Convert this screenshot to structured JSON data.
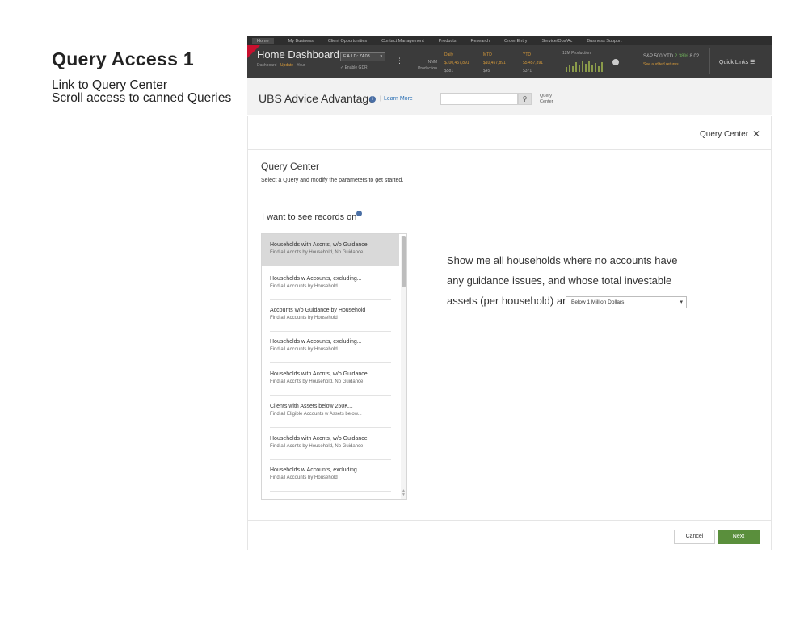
{
  "annotation": {
    "title": "Query Access 1",
    "line1": "Link to Query Center",
    "line2": "Scroll access to canned Queries"
  },
  "topnav": {
    "links": [
      "Home",
      "My Business",
      "Client Opportunities",
      "Contact Management",
      "Products",
      "Research",
      "Order Entry",
      "Service/Ops/Ac",
      "Business Support"
    ],
    "title": "Home Dashboard",
    "subtitle_a": "Dashboard",
    "subtitle_b": "Update",
    "subtitle_c": "Your",
    "faid_label": "F.A.I.D:",
    "faid_value": "ZA03",
    "enable_label": "Enable GDRI",
    "kpi_label_1": "NNM",
    "kpi_label_2": "Production",
    "kpi_daily_label": "Daily",
    "kpi_daily_value": "$100,457,891",
    "kpi_daily_sub": "$581",
    "kpi_mtd_label": "MTD",
    "kpi_mtd_value": "$10,457,891",
    "kpi_mtd_sub": "$45",
    "kpi_ytd_label": "YTD",
    "kpi_ytd_value": "$5,457,891",
    "kpi_ytd_sub": "$371",
    "spark_label": "12M Production",
    "sp_index": "S&P 500 YTD",
    "sp_change": "2.38%",
    "sp_points": "8.02",
    "sp_link": "See audited returns",
    "quick_links": "Quick Links"
  },
  "advice": {
    "title": "UBS Advice Advantage",
    "learn_more": "Learn More",
    "search_placeholder": "",
    "query_center_line1": "Query",
    "query_center_line2": "Center"
  },
  "panel": {
    "header_title": "Query Center",
    "title": "Query Center",
    "subtitle": "Select a Query and modify the parameters to get started.",
    "prompt": "I want to see records on",
    "items": [
      {
        "title": "Households with Accnts, w/o Guidance",
        "sub": "Find all Accnts by Household, No Guidance"
      },
      {
        "title": "Households w Accounts, excluding...",
        "sub": "Find all Accounts by Household"
      },
      {
        "title": "Accounts w/o Guidance by Household",
        "sub": "Find all Accounts by Household"
      },
      {
        "title": "Households w Accounts, excluding...",
        "sub": "Find all Accounts by Household"
      },
      {
        "title": "Households with Accnts, w/o Guidance",
        "sub": "Find all Accnts by Household, No Guidance"
      },
      {
        "title": "Clients with Assets below 250K...",
        "sub": "Find all Eligible Accounts w Assets below..."
      },
      {
        "title": "Households with Accnts, w/o Guidance",
        "sub": "Find all Accnts by Household, No Guidance"
      },
      {
        "title": "Households w Accounts, excluding...",
        "sub": "Find all Accounts by Household"
      }
    ],
    "sentence_1": "Show me all households where no accounts have",
    "sentence_2": "any guidance issues, and whose total investable",
    "sentence_3": "assets (per household) are",
    "dropdown_value": "Below 1 Million Dollars",
    "cancel": "Cancel",
    "next": "Next"
  },
  "colors": {
    "accent_green": "#5a8f3c",
    "nav_dark": "#3b3b3b",
    "link_blue": "#2a6fb4",
    "brand_red": "#c8102e"
  }
}
